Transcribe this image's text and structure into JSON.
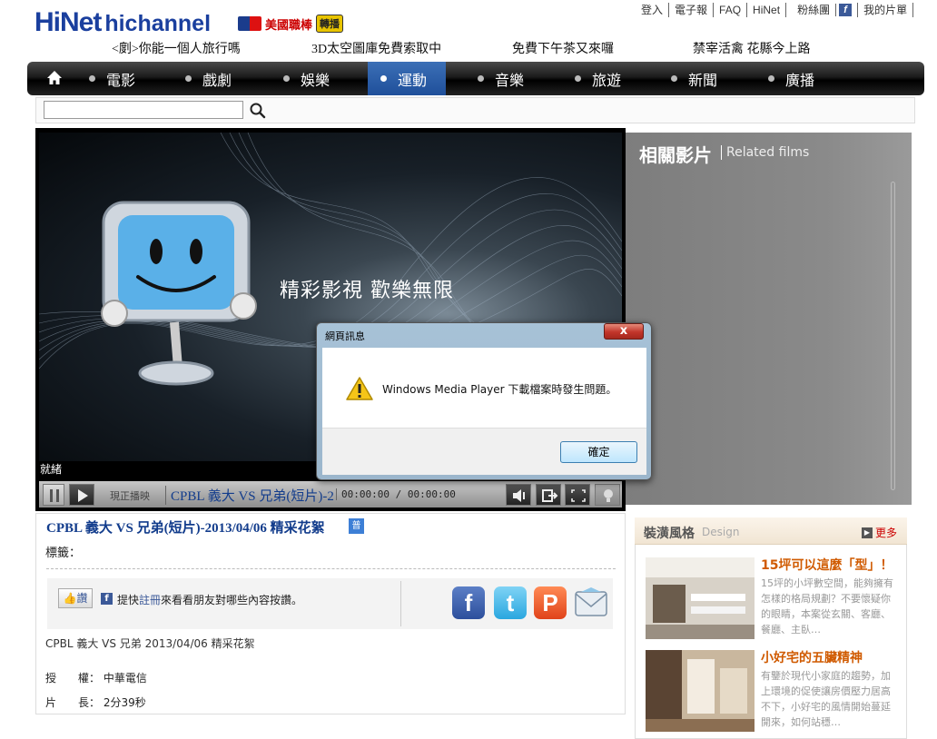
{
  "header": {
    "logo_main": "HiNet",
    "logo_sub": "hichannel",
    "mlb_label": "美國職棒",
    "mlb_relay": "轉播",
    "top_links": [
      "登入",
      "電子報",
      "FAQ",
      "HiNet",
      "粉絲團",
      "我的片單"
    ],
    "promos": [
      "<剫>你能一個人旅行嗎",
      "3D太空圖庫免費索取中",
      "免費下午茶又來囉",
      "禁宰活禽 花縣今上路"
    ]
  },
  "nav": {
    "items": [
      "電影",
      "戲劇",
      "娛樂",
      "運動",
      "音樂",
      "旅遊",
      "新聞",
      "廣播"
    ],
    "active": "運動"
  },
  "search": {
    "placeholder": ""
  },
  "player": {
    "tagline": "精彩影視  歡樂無限",
    "status": "就緒",
    "now_label": "現正播映",
    "now_title": "CPBL 義大 VS 兄弟(短片)-2",
    "timecode": "00:00:00 / 00:00:00"
  },
  "dialog": {
    "title": "網頁訊息",
    "message": "Windows Media Player 下載檔案時發生問題。",
    "ok_label": "確定",
    "close_label": "x"
  },
  "related": {
    "title": "相關影片",
    "subtitle": "Related films"
  },
  "video_info": {
    "title": "CPBL 義大 VS 兄弟(短片)-2013/04/06 精采花絮",
    "badge": "普",
    "tags_label": "標籤：",
    "like_label": "讚",
    "fb_prompt_pre": "提快",
    "fb_prompt_reg": "註冊",
    "fb_prompt_post": "來看看朋友對哪些內容按讚。",
    "description": "CPBL 義大 VS 兄弟 2013/04/06 精采花絮",
    "rights": "授　　權： 中華電信",
    "length": "片　　長： 2分39秒"
  },
  "design": {
    "title": "裝潢風格",
    "subtitle": "Design",
    "more_label": "更多",
    "articles": [
      {
        "title": "15坪可以這麼「型」！",
        "body": "15坪的小坪數空間，能夠擁有怎樣的格局規劃？不要懷疑你的眼睛，本案從玄關、客廳、餐廳、主臥…"
      },
      {
        "title": "小好宅的五臟精神",
        "body": "有鑒於現代小家庭的趨勢，加上環境的促使讓房價壓力居高不下，小好宅的風情開始蔓延開來，如何站穩…"
      }
    ]
  },
  "colors": {
    "brand_blue": "#1a3f9e",
    "nav_active": "#2a5fa8",
    "accent_orange": "#d05a00"
  }
}
